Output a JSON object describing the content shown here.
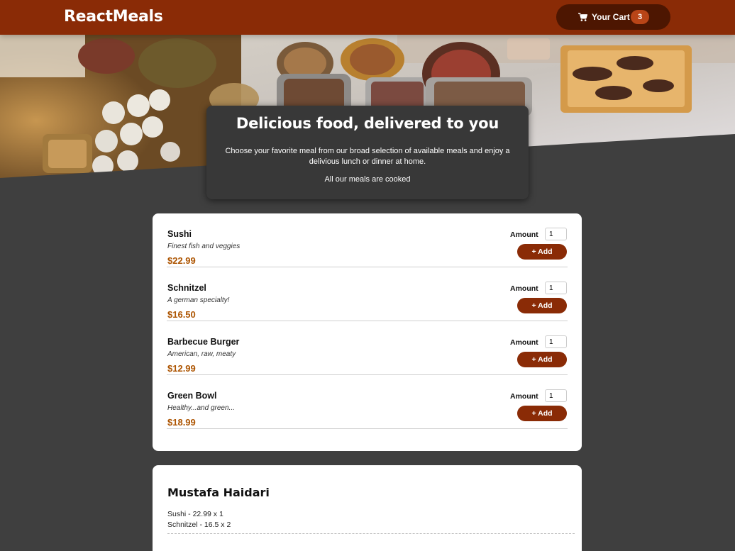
{
  "header": {
    "brand": "ReactMeals",
    "cart": {
      "label": "Your Cart",
      "count": "3",
      "icon": "cart-icon"
    }
  },
  "colors": {
    "header_bg": "#8a2b06",
    "page_bg": "#3f3f3f",
    "price": "#ad5502",
    "add_button": "#8a2b06",
    "cart_button": "#4d1601",
    "badge": "#b94517"
  },
  "summary": {
    "title": "Delicious food, delivered to you",
    "text": "Choose your favorite meal from our broad selection of available meals and enjoy a delivious lunch or dinner at home.",
    "text2": "All our meals are cooked"
  },
  "meals": [
    {
      "name": "Sushi",
      "description": "Finest fish and veggies",
      "price": "$22.99",
      "amount_label": "Amount",
      "amount_value": "1",
      "add_label": "+ Add"
    },
    {
      "name": "Schnitzel",
      "description": "A german specialty!",
      "price": "$16.50",
      "amount_label": "Amount",
      "amount_value": "1",
      "add_label": "+ Add"
    },
    {
      "name": "Barbecue Burger",
      "description": "American, raw, meaty",
      "price": "$12.99",
      "amount_label": "Amount",
      "amount_value": "1",
      "add_label": "+ Add"
    },
    {
      "name": "Green Bowl",
      "description": "Healthy...and green...",
      "price": "$18.99",
      "amount_label": "Amount",
      "amount_value": "1",
      "add_label": "+ Add"
    }
  ],
  "order": {
    "customer": "Mustafa Haidari",
    "items": [
      "Sushi - 22.99 x 1",
      "Schnitzel - 16.5 x 2"
    ]
  }
}
